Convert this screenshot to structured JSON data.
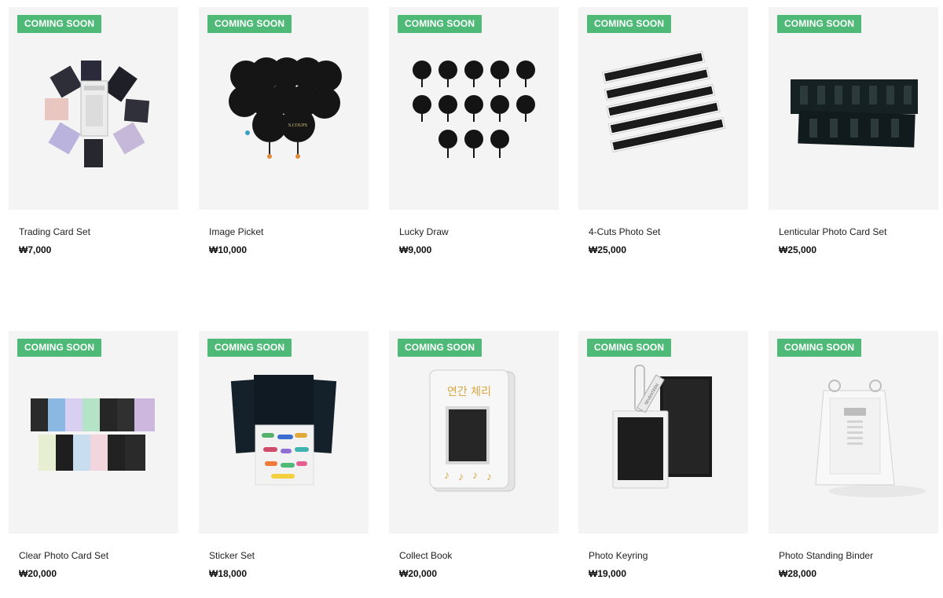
{
  "badge_label": "COMING SOON",
  "accent_color": "#4fb978",
  "products": [
    {
      "name": "Trading Card Set",
      "price": "₩7,000",
      "image": "trading-card-set-image"
    },
    {
      "name": "Image Picket",
      "price": "₩10,000",
      "image": "image-picket-image",
      "image_text": "S.COUPS"
    },
    {
      "name": "Lucky Draw",
      "price": "₩9,000",
      "image": "lucky-draw-image"
    },
    {
      "name": "4-Cuts Photo Set",
      "price": "₩25,000",
      "image": "four-cuts-photo-set-image"
    },
    {
      "name": "Lenticular Photo Card Set",
      "price": "₩25,000",
      "image": "lenticular-photo-card-set-image"
    },
    {
      "name": "Clear Photo Card Set",
      "price": "₩20,000",
      "image": "clear-photo-card-set-image"
    },
    {
      "name": "Sticker Set",
      "price": "₩18,000",
      "image": "sticker-set-image"
    },
    {
      "name": "Collect Book",
      "price": "₩20,000",
      "image": "collect-book-image",
      "image_text": "연간 체리"
    },
    {
      "name": "Photo Keyring",
      "price": "₩19,000",
      "image": "photo-keyring-image",
      "image_text": "SEVENTEEN"
    },
    {
      "name": "Photo Standing Binder",
      "price": "₩28,000",
      "image": "photo-standing-binder-image"
    }
  ]
}
